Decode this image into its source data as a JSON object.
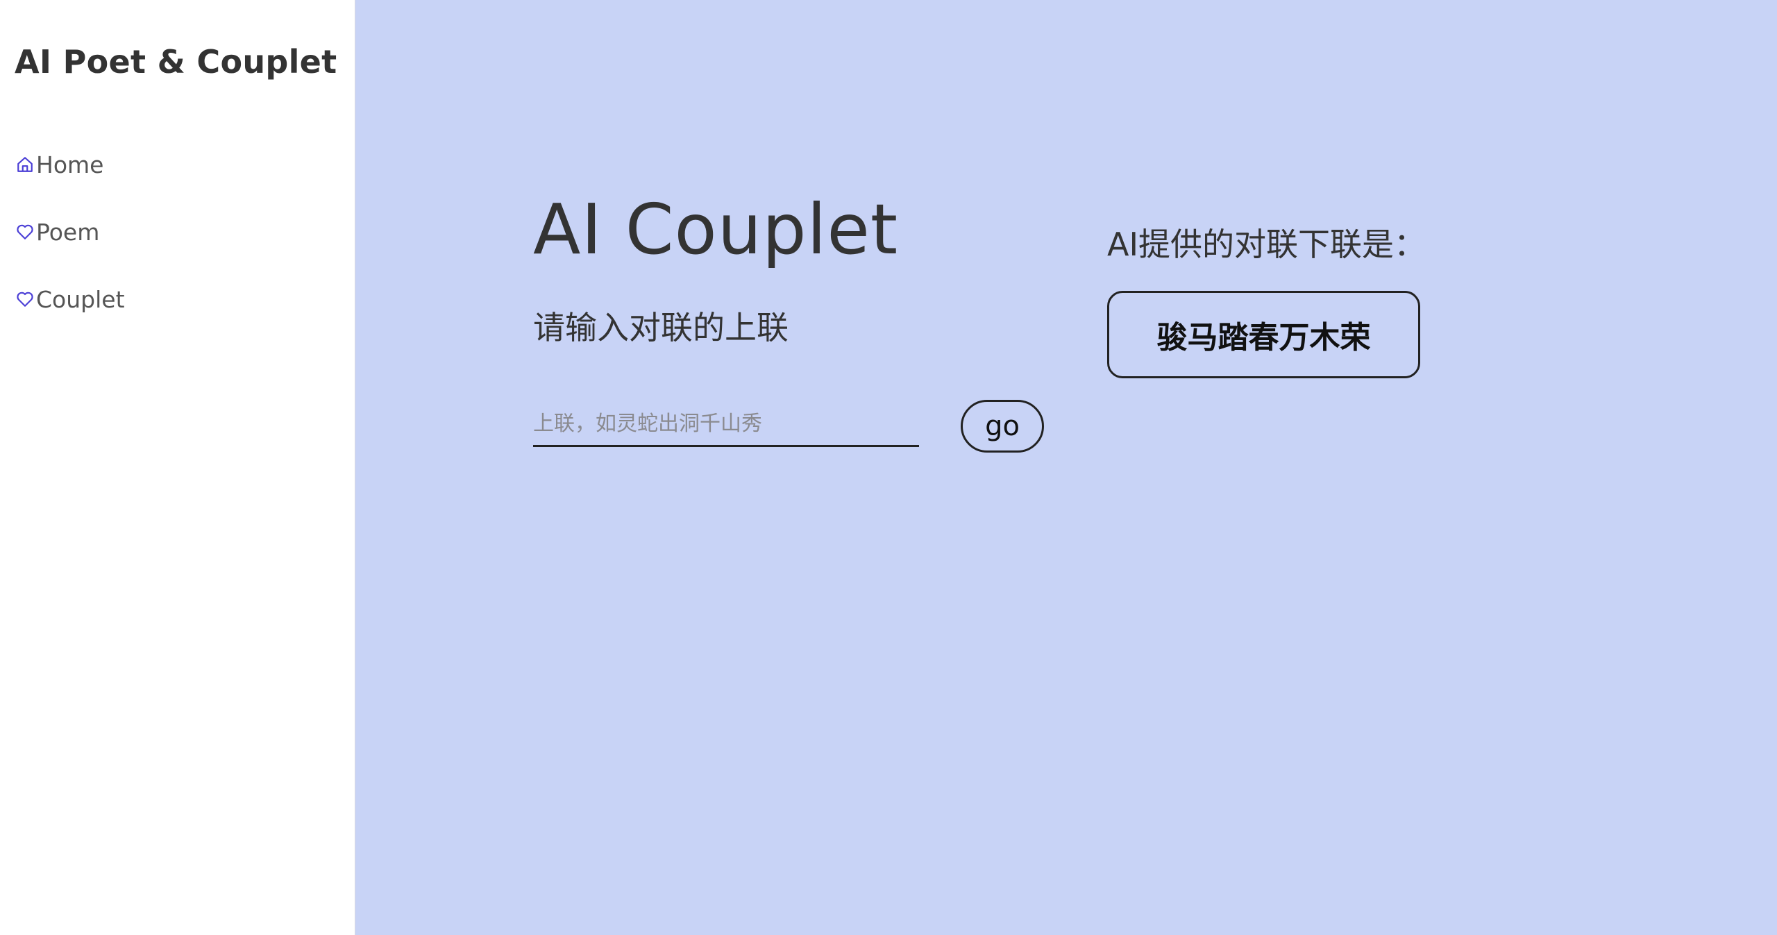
{
  "app": {
    "title": "AI Poet & Couplet"
  },
  "sidebar": {
    "items": [
      {
        "label": "Home",
        "icon": "home-icon"
      },
      {
        "label": "Poem",
        "icon": "heart-icon"
      },
      {
        "label": "Couplet",
        "icon": "heart-icon"
      }
    ]
  },
  "main": {
    "title": "AI Couplet",
    "prompt": "请输入对联的上联",
    "input": {
      "value": "",
      "placeholder": "上联，如灵蛇出洞千山秀"
    },
    "go_label": "go",
    "result_label": "AI提供的对联下联是：",
    "result_value": "骏马踏春万木荣"
  },
  "colors": {
    "main_background": "#c8d3f6",
    "sidebar_background": "#ffffff",
    "icon_accent": "#4b3fd6",
    "text": "#333333"
  }
}
